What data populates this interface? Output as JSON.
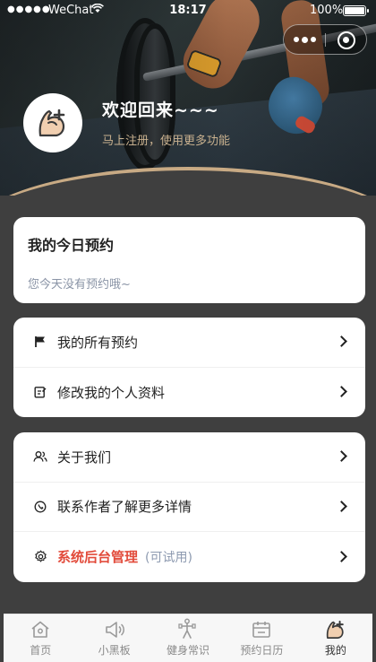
{
  "status_bar": {
    "carrier": "WeChat",
    "time": "18:17",
    "battery_percent": "100%",
    "signal_icon": "signal-dots-icon",
    "wifi_icon": "wifi-icon"
  },
  "header": {
    "welcome_title": "欢迎回来~~~",
    "welcome_subtitle": "马上注册，使用更多功能",
    "accent_color": "#c9b18f",
    "avatar_icon": "muscle-plus-icon"
  },
  "capsule": {
    "more_icon": "more-dots-icon",
    "close_icon": "circle-target-icon"
  },
  "today": {
    "title": "我的今日预约",
    "empty_text": "您今天没有预约哦~"
  },
  "menu_group_1": [
    {
      "label": "我的所有预约",
      "icon": "flag-icon"
    },
    {
      "label": "修改我的个人资料",
      "icon": "edit-icon"
    }
  ],
  "menu_group_2": [
    {
      "label": "关于我们",
      "icon": "users-icon"
    },
    {
      "label": "联系作者了解更多详情",
      "icon": "contact-icon"
    },
    {
      "label": "系统后台管理",
      "note": "(可试用)",
      "icon": "gear-icon",
      "label_color": "#e24b3b"
    }
  ],
  "tabbar": [
    {
      "label": "首页",
      "icon": "home-icon",
      "active": false
    },
    {
      "label": "小黑板",
      "icon": "megaphone-icon",
      "active": false
    },
    {
      "label": "健身常识",
      "icon": "fitness-icon",
      "active": false
    },
    {
      "label": "预约日历",
      "icon": "calendar-icon",
      "active": false
    },
    {
      "label": "我的",
      "icon": "muscle-plus-icon",
      "active": true
    }
  ]
}
